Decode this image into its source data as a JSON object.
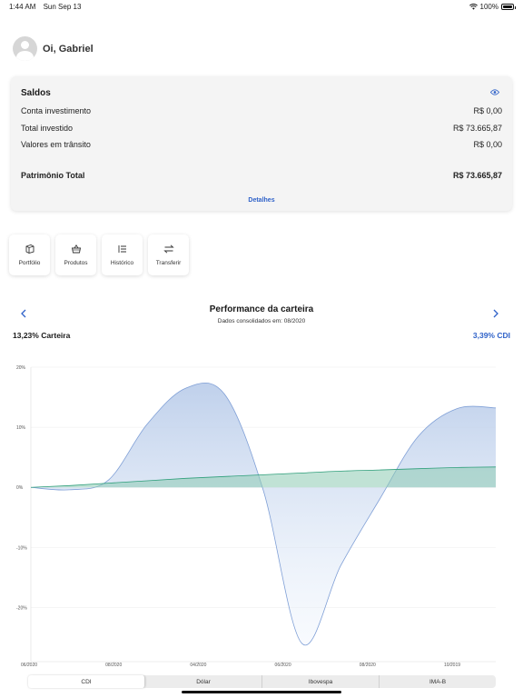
{
  "status_bar": {
    "time": "1:44 AM",
    "date": "Sun Sep 13",
    "battery": "100%"
  },
  "greeting": "Oi, Gabriel",
  "saldos": {
    "title": "Saldos",
    "rows": [
      {
        "label": "Conta investimento",
        "value": "R$ 0,00"
      },
      {
        "label": "Total investido",
        "value": "R$ 73.665,87"
      },
      {
        "label": "Valores em trânsito",
        "value": "R$ 0,00"
      }
    ],
    "total": {
      "label": "Patrimônio Total",
      "value": "R$ 73.665,87"
    },
    "details_link": "Detalhes"
  },
  "actions": [
    {
      "label": "Portfólio",
      "icon": "portfolio-icon"
    },
    {
      "label": "Produtos",
      "icon": "basket-icon"
    },
    {
      "label": "Histórico",
      "icon": "list-icon"
    },
    {
      "label": "Transferir",
      "icon": "transfer-icon"
    }
  ],
  "performance": {
    "title": "Performance da carteira",
    "subtitle": "Dados consolidados em: 08/2020",
    "left_value": "13,23% Carteira",
    "right_value": "3,39% CDI"
  },
  "tabs": [
    {
      "label": "CDI",
      "active": true
    },
    {
      "label": "Dólar",
      "active": false
    },
    {
      "label": "Ibovespa",
      "active": false
    },
    {
      "label": "IMA-B",
      "active": false
    }
  ],
  "colors": {
    "accent": "#2f62c9",
    "carteira": "#7f9fd6",
    "cdi": "#2e9e7a"
  },
  "chart_data": {
    "type": "area",
    "x_tick_labels": [
      "06/2020",
      "08/2020",
      "04/2020",
      "06/2020",
      "08/2020",
      "10/2019"
    ],
    "y_tick_labels": [
      "20%",
      "10%",
      "0%",
      "-10%",
      "-20%"
    ],
    "ylim": [
      -29,
      20
    ],
    "grid": true,
    "series": [
      {
        "values": [
          0,
          -0.4,
          1.2,
          10.5,
          16.5,
          15.5,
          -0.5,
          -26,
          -13,
          -2,
          8.5,
          13.1,
          13.23
        ]
      },
      {
        "values": [
          0,
          0.3,
          0.7,
          1.1,
          1.5,
          1.8,
          2.1,
          2.4,
          2.7,
          2.9,
          3.1,
          3.3,
          3.39
        ]
      }
    ]
  }
}
